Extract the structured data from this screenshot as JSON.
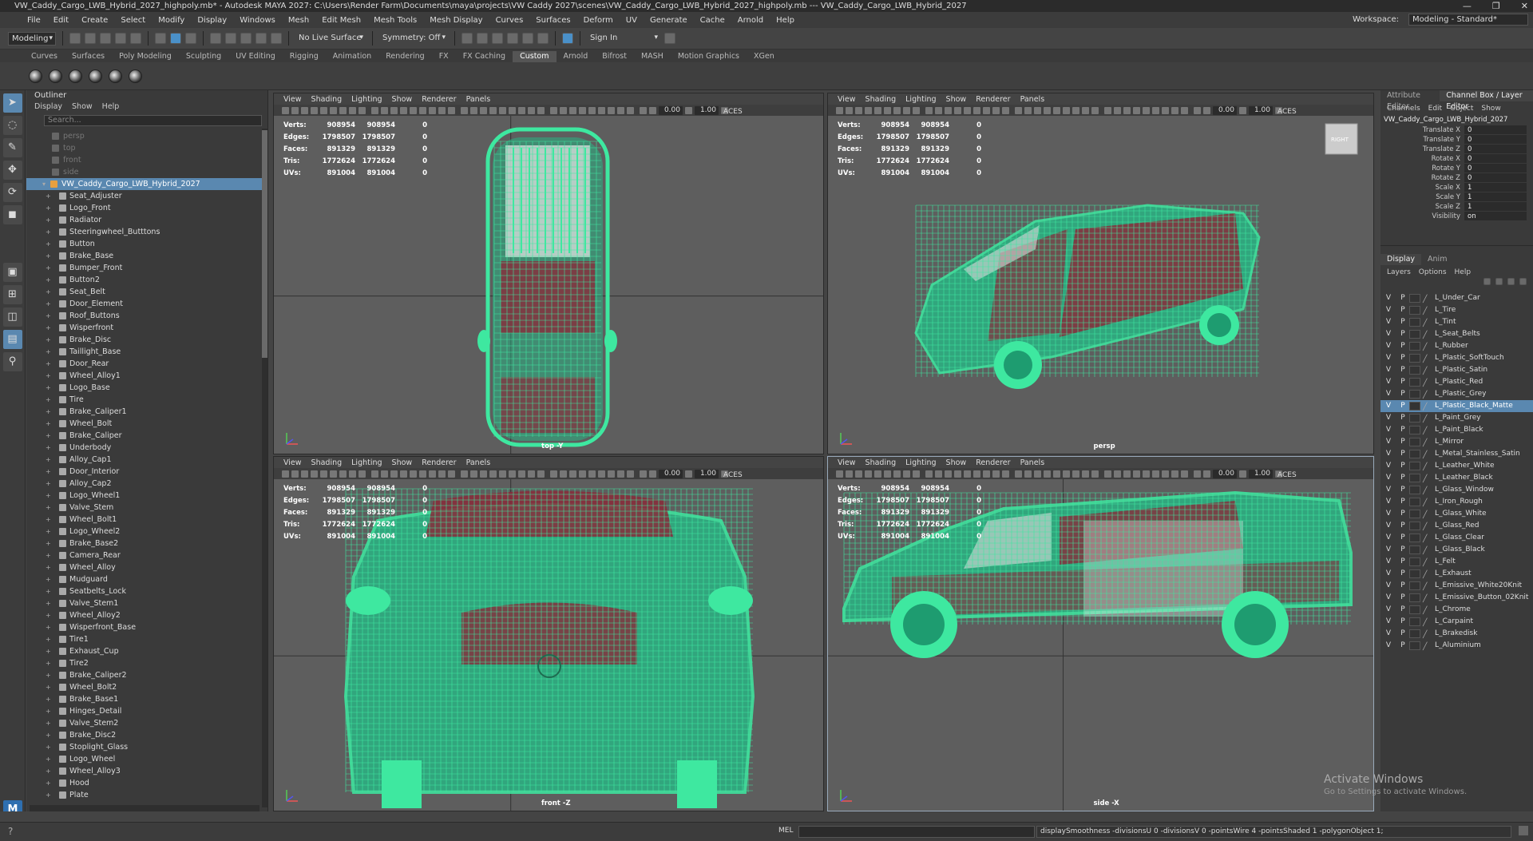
{
  "titlebar": {
    "text": "VW_Caddy_Cargo_LWB_Hybrid_2027_highpoly.mb* - Autodesk MAYA 2027: C:\\Users\\Render Farm\\Documents\\maya\\projects\\VW Caddy 2027\\scenes\\VW_Caddy_Cargo_LWB_Hybrid_2027_highpoly.mb  ---  VW_Caddy_Cargo_LWB_Hybrid_2027",
    "minimize": "—",
    "restore": "❐",
    "close": "✕"
  },
  "menubar": {
    "items": [
      "File",
      "Edit",
      "Create",
      "Select",
      "Modify",
      "Display",
      "Windows",
      "Mesh",
      "Edit Mesh",
      "Mesh Tools",
      "Mesh Display",
      "Curves",
      "Surfaces",
      "Deform",
      "UV",
      "Generate",
      "Cache",
      "Arnold",
      "Help"
    ],
    "workspace_label": "Workspace:",
    "workspace_value": "Modeling - Standard*"
  },
  "statusline": {
    "mode": "Modeling",
    "live_surface": "No Live Surface",
    "symmetry": "Symmetry: Off",
    "sign_in": "Sign In"
  },
  "shelf": {
    "tabs": [
      "Curves",
      "Surfaces",
      "Poly Modeling",
      "Sculpting",
      "UV Editing",
      "Rigging",
      "Animation",
      "Rendering",
      "FX",
      "FX Caching",
      "Custom",
      "Arnold",
      "Bifrost",
      "MASH",
      "Motion Graphics",
      "XGen"
    ],
    "active": "Custom"
  },
  "outliner": {
    "title": "Outliner",
    "menu": [
      "Display",
      "Show",
      "Help"
    ],
    "search_placeholder": "Search...",
    "cameras": [
      "persp",
      "top",
      "front",
      "side"
    ],
    "root": "VW_Caddy_Cargo_LWB_Hybrid_2027",
    "children": [
      "Seat_Adjuster",
      "Logo_Front",
      "Radiator",
      "Steeringwheel_Butttons",
      "Button",
      "Brake_Base",
      "Bumper_Front",
      "Button2",
      "Seat_Belt",
      "Door_Element",
      "Roof_Buttons",
      "Wisperfront",
      "Brake_Disc",
      "Taillight_Base",
      "Door_Rear",
      "Wheel_Alloy1",
      "Logo_Base",
      "Tire",
      "Brake_Caliper1",
      "Wheel_Bolt",
      "Brake_Caliper",
      "Underbody",
      "Alloy_Cap1",
      "Door_Interior",
      "Alloy_Cap2",
      "Logo_Wheel1",
      "Valve_Stem",
      "Wheel_Bolt1",
      "Logo_Wheel2",
      "Brake_Base2",
      "Camera_Rear",
      "Wheel_Alloy",
      "Mudguard",
      "Seatbelts_Lock",
      "Valve_Stem1",
      "Wheel_Alloy2",
      "Wisperfront_Base",
      "Tire1",
      "Exhaust_Cup",
      "Tire2",
      "Brake_Caliper2",
      "Wheel_Bolt2",
      "Brake_Base1",
      "Hinges_Detail",
      "Valve_Stem2",
      "Brake_Disc2",
      "Stoplight_Glass",
      "Logo_Wheel",
      "Wheel_Alloy3",
      "Hood",
      "Plate"
    ]
  },
  "viewport_menu": [
    "View",
    "Shading",
    "Lighting",
    "Show",
    "Renderer",
    "Panels"
  ],
  "viewport_tools": {
    "exposure": "0.00",
    "gamma": "1.00",
    "colorspace": "ACES"
  },
  "hud": {
    "rows": [
      {
        "label": "Verts:",
        "a": "908954",
        "b": "908954",
        "c": "0"
      },
      {
        "label": "Edges:",
        "a": "1798507",
        "b": "1798507",
        "c": "0"
      },
      {
        "label": "Faces:",
        "a": "891329",
        "b": "891329",
        "c": "0"
      },
      {
        "label": "Tris:",
        "a": "1772624",
        "b": "1772624",
        "c": "0"
      },
      {
        "label": "UVs:",
        "a": "891004",
        "b": "891004",
        "c": "0"
      }
    ]
  },
  "viewports": [
    {
      "label": "top -Y"
    },
    {
      "label": "persp"
    },
    {
      "label": "front -Z"
    },
    {
      "label": "side -X"
    }
  ],
  "viewcube_label": "RIGHT",
  "channelbox": {
    "tabs": [
      "Attribute Editor",
      "Channel Box / Layer Editor"
    ],
    "menu": [
      "Channels",
      "Edit",
      "Object",
      "Show"
    ],
    "object": "VW_Caddy_Cargo_LWB_Hybrid_2027",
    "attrs": [
      {
        "n": "Translate X",
        "v": "0"
      },
      {
        "n": "Translate Y",
        "v": "0"
      },
      {
        "n": "Translate Z",
        "v": "0"
      },
      {
        "n": "Rotate X",
        "v": "0"
      },
      {
        "n": "Rotate Y",
        "v": "0"
      },
      {
        "n": "Rotate Z",
        "v": "0"
      },
      {
        "n": "Scale X",
        "v": "1"
      },
      {
        "n": "Scale Y",
        "v": "1"
      },
      {
        "n": "Scale Z",
        "v": "1"
      },
      {
        "n": "Visibility",
        "v": "on"
      }
    ]
  },
  "layereditor": {
    "tabs": [
      "Display",
      "Anim"
    ],
    "menu": [
      "Layers",
      "Options",
      "Help"
    ],
    "v": "V",
    "p": "P",
    "selected": "L_Plastic_Black_Matte",
    "layers": [
      "L_Under_Car",
      "L_Tire",
      "L_Tint",
      "L_Seat_Belts",
      "L_Rubber",
      "L_Plastic_SoftTouch",
      "L_Plastic_Satin",
      "L_Plastic_Red",
      "L_Plastic_Grey",
      "L_Plastic_Black_Matte",
      "L_Paint_Grey",
      "L_Paint_Black",
      "L_Mirror",
      "L_Metal_Stainless_Satin",
      "L_Leather_White",
      "L_Leather_Black",
      "L_Glass_Window",
      "L_Iron_Rough",
      "L_Glass_White",
      "L_Glass_Red",
      "L_Glass_Clear",
      "L_Glass_Black",
      "L_Felt",
      "L_Exhaust",
      "L_Emissive_White20Knit",
      "L_Emissive_Button_02Knit",
      "L_Chrome",
      "L_Carpaint",
      "L_Brakedisk",
      "L_Aluminium"
    ]
  },
  "cmdline": {
    "lang": "MEL",
    "result": "displaySmoothness -divisionsU 0 -divisionsV 0 -pointsWire 4 -pointsShaded 1 -polygonObject 1;"
  },
  "activate": {
    "title": "Activate Windows",
    "sub": "Go to Settings to activate Windows."
  },
  "colors": {
    "wire": "#3ee8a0",
    "paint": "#8a2a3a",
    "bg": "#5e5e5e",
    "accent": "#5a88b0"
  }
}
